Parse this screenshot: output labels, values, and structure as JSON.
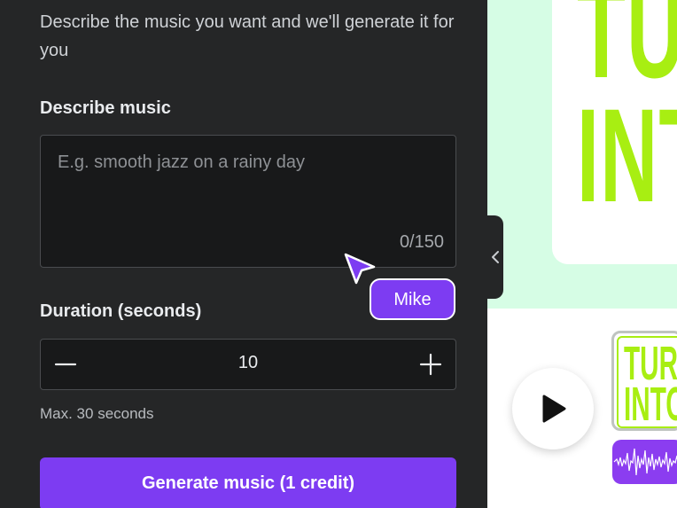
{
  "panel": {
    "intro": "Describe the music you want and we'll generate it for you",
    "describe_label": "Describe music",
    "describe_placeholder": "E.g. smooth jazz on a rainy day",
    "char_counter": "0/150",
    "duration_label": "Duration (seconds)",
    "duration_value": "10",
    "duration_helper": "Max. 30 seconds",
    "generate_button": "Generate music (1 credit)"
  },
  "collaborator": {
    "name": "Mike",
    "color": "#7d3cf2"
  },
  "canvas": {
    "design_text_line1": "TUR",
    "design_text_line2": "INT",
    "thumb_text_line1": "TURN",
    "thumb_text_line2": "INTO",
    "accent_lime": "#a8ee12",
    "background_mint": "#d6fde5"
  },
  "icons": {
    "collapse": "chevron-left-icon",
    "decrement": "minus-icon",
    "increment": "plus-icon",
    "play": "play-icon",
    "cursor": "pointer-cursor-icon",
    "audio": "waveform-icon"
  },
  "colors": {
    "primary": "#7d3cf2",
    "panel_bg": "#252627",
    "input_bg": "#18191a"
  }
}
